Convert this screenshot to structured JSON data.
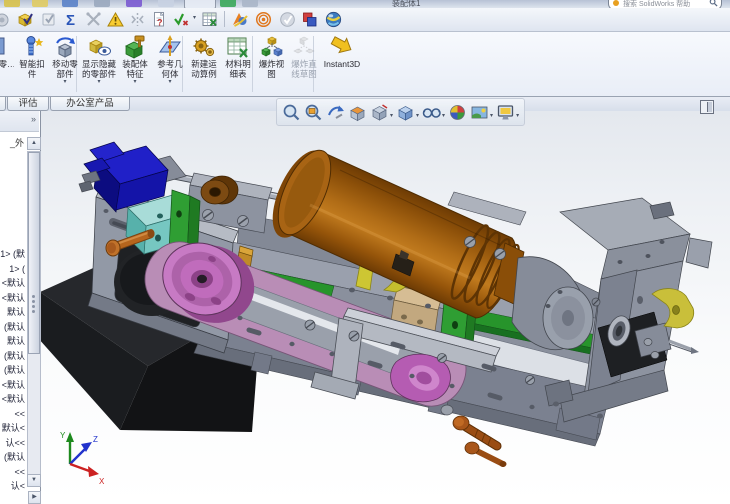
{
  "titlebar": {
    "title_fragment": "装配体1",
    "search_placeholder": "搜索 SolidWorks 帮助"
  },
  "glyphs": {
    "caret": "▾",
    "chevron": "»",
    "up": "▲",
    "down": "▼",
    "right": "▶",
    "sigma": "Σ",
    "question": "?"
  },
  "toolbar": {
    "icons": [
      {
        "name": "interference-partial-icon",
        "disabled": true
      },
      {
        "name": "verification-box-icon"
      },
      {
        "name": "checkbox-grayed-icon",
        "disabled": true
      },
      {
        "name": "equations-sigma-icon"
      },
      {
        "name": "measure-grayed-icon",
        "disabled": true
      },
      {
        "name": "warning-triangle-icon"
      },
      {
        "name": "symmetry-grayed-icon",
        "disabled": true
      },
      {
        "name": "file-question-icon"
      },
      {
        "name": "design-check-icon"
      },
      {
        "name": "excel-table-icon"
      },
      {
        "name": "presentation-colorful-icon"
      },
      {
        "name": "rings-orange-icon"
      },
      {
        "name": "circle-check-grayed-icon",
        "disabled": true
      },
      {
        "name": "compare-squares-icon"
      },
      {
        "name": "edrawings-sphere-icon"
      }
    ]
  },
  "ribbon": {
    "buttons": [
      {
        "label": "零…",
        "partial": true
      },
      {
        "label": "智能扣件"
      },
      {
        "label": "移动零部件",
        "dropdown": true
      },
      {
        "label": "显示隐藏的零部件",
        "dropdown": true
      },
      {
        "label": "装配体特征",
        "dropdown": true
      },
      {
        "label": "参考几何体",
        "dropdown": true
      },
      {
        "label": "新建运动算例"
      },
      {
        "label": "材料明细表"
      },
      {
        "label": "爆炸视图"
      },
      {
        "label": "爆炸直线草图",
        "disabled": true
      },
      {
        "label": "Instant3D"
      }
    ]
  },
  "tabs": {
    "items": [
      {
        "label": "评估"
      },
      {
        "label": "办公室产品"
      }
    ]
  },
  "feature_panel": {
    "header_fragment": "_外",
    "items": [
      "1> (默",
      "1> (",
      "<默认",
      "<默认",
      "默认",
      "(默认",
      "默认",
      "(默认",
      "(默认",
      "<默认",
      "<默认",
      "<<",
      "默认<",
      "认<<",
      "(默认",
      "<<",
      "认<"
    ]
  },
  "viewport": {
    "headsup_icons": [
      "zoom-to-fit",
      "zoom-to-area",
      "previous-view",
      "section-view",
      "view-orientation",
      "display-style",
      "hide-show-items",
      "edit-appearance",
      "apply-scene",
      "view-settings"
    ],
    "triad": {
      "x_label": "X",
      "y_label": "Y",
      "z_label": "Z"
    }
  },
  "model": {
    "parts": [
      "black-base-plate",
      "base-frame",
      "left-end-plate",
      "guide-rod",
      "blue-stepper-motor",
      "cyan-guide-block",
      "green-bracket",
      "green-rails",
      "idler-roller-brown",
      "copper-pin",
      "brass-fitting",
      "belt-pink",
      "pulley-magenta",
      "magenta-scoop",
      "tan-block",
      "yellow-clamp",
      "spindle-motor-brown",
      "spindle-head",
      "right-mounting-bracket",
      "black-side-block",
      "collar-nut",
      "tool-bit",
      "yellow-small-clamp",
      "l-bracket",
      "brown-bolts"
    ]
  },
  "colors": {
    "frame_gray": "#9aa0ad",
    "frame_gray_mid": "#8a909d",
    "frame_gray_dark": "#7b8190",
    "left_plate": "#9299a6",
    "spindle_brown": "#a35f0e",
    "spindle_cap": "#a86414",
    "belt_pink": "#b98db6",
    "pulley_magenta": "#c77ac4",
    "scoop_magenta": "#b55cb2",
    "motor_blue": "#1414a8",
    "cyan_block": "#76c7c1",
    "accent_green": "#2f9e33",
    "green_rail": "#27942b",
    "yellow_clamp": "#cdc633",
    "yellow_small": "#c9bf3a",
    "tan_block": "#c2a87f",
    "black_part": "#121315",
    "roller_brown": "#7c4a12",
    "copper": "#b5651d",
    "brass": "#c08a28"
  }
}
